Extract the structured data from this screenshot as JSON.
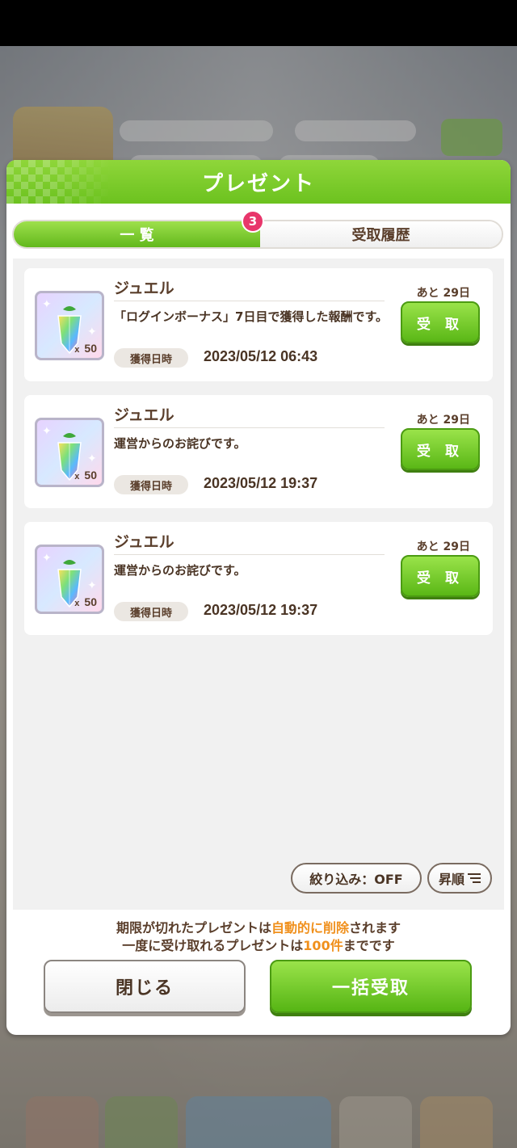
{
  "dialog": {
    "title": "プレゼント",
    "tabs": [
      {
        "label": "一 覧",
        "active": true,
        "badge": "3"
      },
      {
        "label": "受取履歴",
        "active": false
      }
    ]
  },
  "presents": [
    {
      "name": "ジュエル",
      "description": "「ログインボーナス」7日目で獲得した報酬です。",
      "date_label": "獲得日時",
      "date": "2023/05/12 06:43",
      "remaining": "あと 29日",
      "claim_label": "受 取",
      "quantity": "50",
      "quantity_prefix": "x"
    },
    {
      "name": "ジュエル",
      "description": "運営からのお詫びです。",
      "date_label": "獲得日時",
      "date": "2023/05/12 19:37",
      "remaining": "あと 29日",
      "claim_label": "受 取",
      "quantity": "50",
      "quantity_prefix": "x"
    },
    {
      "name": "ジュエル",
      "description": "運営からのお詫びです。",
      "date_label": "獲得日時",
      "date": "2023/05/12 19:37",
      "remaining": "あと 29日",
      "claim_label": "受 取",
      "quantity": "50",
      "quantity_prefix": "x"
    }
  ],
  "controls": {
    "filter_label": "絞り込み：OFF",
    "sort_label": "昇順",
    "sort_icon": "sort-lines-icon"
  },
  "notice": {
    "line1_a": "期限が切れたプレゼントは",
    "line1_highlight": "自動的に削除",
    "line1_b": "されます",
    "line2_a": "一度に受け取れるプレゼントは",
    "line2_highlight": "100件",
    "line2_b": "までです"
  },
  "buttons": {
    "close": "閉じる",
    "bulk_claim": "一括受取"
  },
  "colors": {
    "accent_green": "#6cc21f",
    "badge_pink": "#e8366b",
    "highlight_orange": "#f0901c",
    "text_brown": "#5a3e2b"
  }
}
